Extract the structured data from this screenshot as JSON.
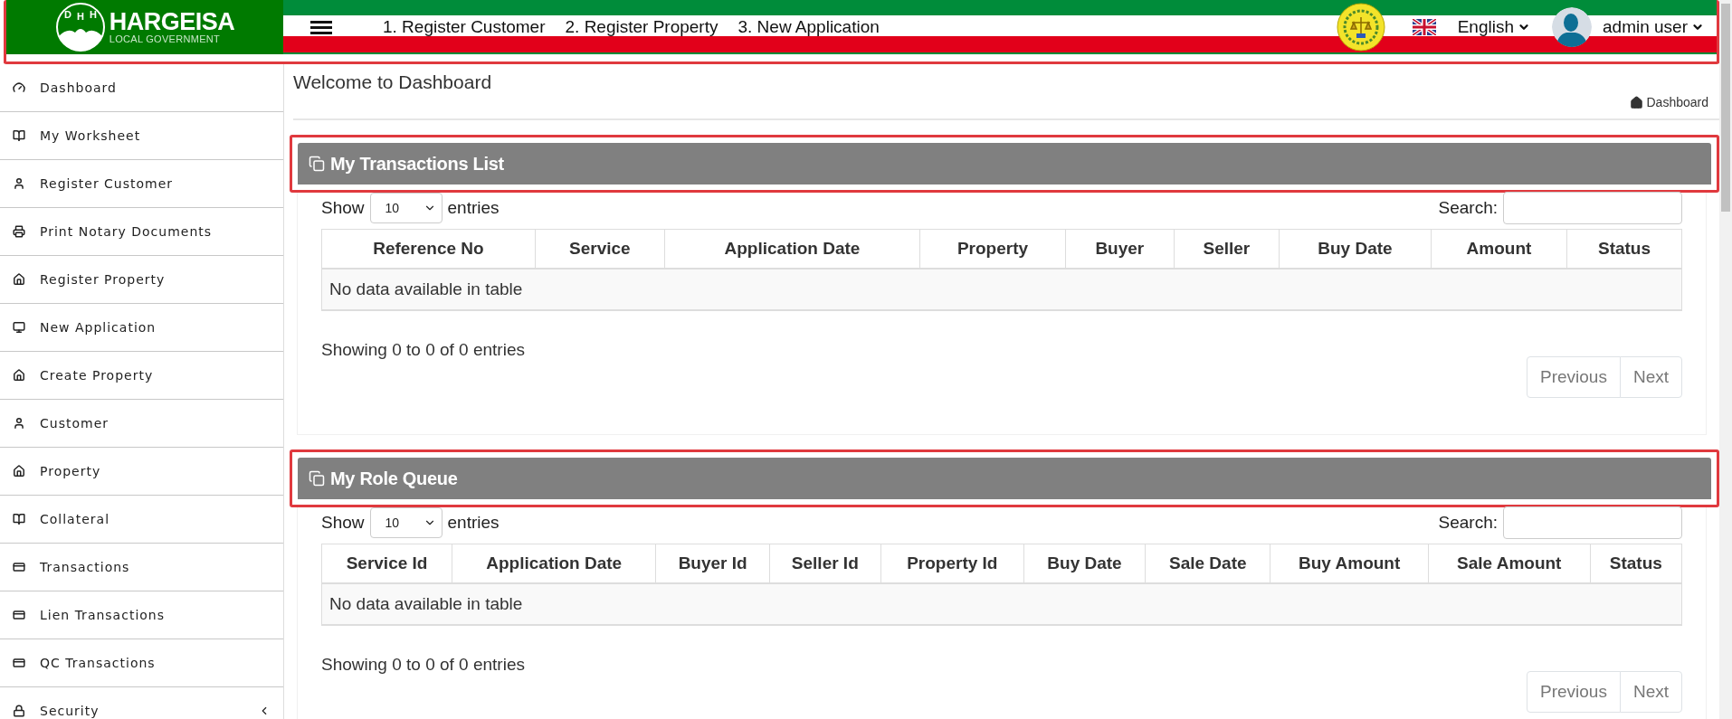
{
  "header": {
    "highlighted": true,
    "logo": {
      "monogram": [
        "D",
        "H",
        "H"
      ],
      "title": "HARGEISA",
      "subtitle": "LOCAL GOVERNMENT"
    },
    "nav_links": [
      "1. Register Customer",
      "2. Register Property",
      "3. New Application"
    ],
    "language": "English",
    "user": "admin user"
  },
  "sidebar": {
    "items": [
      {
        "label": "Dashboard",
        "kind": "dashboard"
      },
      {
        "label": "My Worksheet",
        "kind": "book"
      },
      {
        "label": "Register Customer",
        "kind": "person"
      },
      {
        "label": "Print Notary Documents",
        "kind": "print"
      },
      {
        "label": "Register Property",
        "kind": "home"
      },
      {
        "label": "New Application",
        "kind": "monitor"
      },
      {
        "label": "Create Property",
        "kind": "home"
      },
      {
        "label": "Customer",
        "kind": "person"
      },
      {
        "label": "Property",
        "kind": "home"
      },
      {
        "label": "Collateral",
        "kind": "book"
      },
      {
        "label": "Transactions",
        "kind": "card"
      },
      {
        "label": "Lien Transactions",
        "kind": "card"
      },
      {
        "label": "QC Transactions",
        "kind": "card"
      },
      {
        "label": "Security",
        "kind": "group",
        "expanded": false
      }
    ]
  },
  "page": {
    "title": "Welcome to Dashboard",
    "breadcrumb": "Dashboard"
  },
  "panels": [
    {
      "title": "My Transactions List",
      "highlighted": true,
      "show_label": "Show",
      "page_size": "10",
      "entries_label": "entries",
      "search_label": "Search:",
      "columns": [
        "Reference No",
        "Service",
        "Application Date",
        "Property",
        "Buyer",
        "Seller",
        "Buy Date",
        "Amount",
        "Status"
      ],
      "empty_message": "No data available in table",
      "info": "Showing 0 to 0 of 0 entries",
      "pagination": [
        {
          "label": "Previous",
          "disabled": true
        },
        {
          "label": "Next",
          "disabled": true
        }
      ]
    },
    {
      "title": "My Role Queue",
      "highlighted": true,
      "show_label": "Show",
      "page_size": "10",
      "entries_label": "entries",
      "search_label": "Search:",
      "columns": [
        "Service Id",
        "Application Date",
        "Buyer Id",
        "Seller Id",
        "Property Id",
        "Buy Date",
        "Sale Date",
        "Buy Amount",
        "Sale Amount",
        "Status"
      ],
      "empty_message": "No data available in table",
      "info": "Showing 0 to 0 of 0 entries",
      "pagination": [
        {
          "label": "Previous",
          "disabled": true
        },
        {
          "label": "Next",
          "disabled": true
        }
      ]
    }
  ]
}
